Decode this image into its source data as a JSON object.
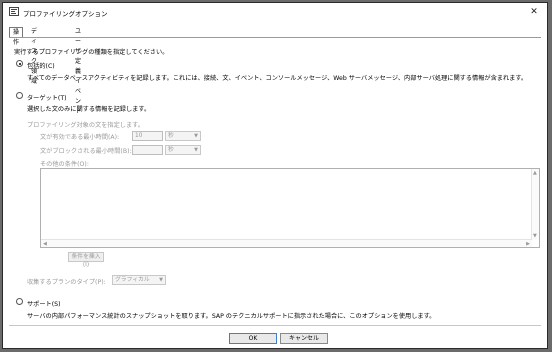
{
  "window": {
    "title": "プロファイリングオプション",
    "close_glyph": "✕"
  },
  "tabs": [
    {
      "label": "操作"
    },
    {
      "label": "ディスク領域"
    },
    {
      "label": "ユーザ定義イベント"
    }
  ],
  "instruction": "実行するプロファイリングの種類を指定してください。",
  "options": {
    "all": {
      "label": "包括的(C)",
      "description": "すべてのデータベースアクティビティを記録します。これには、接続、文、イベント、コンソールメッセージ、Web サーバメッセージ、内部サーバ処理に関する情報が含まれます。",
      "selected": true
    },
    "targeted": {
      "label": "ターゲット(T)",
      "description": "選択した文のみに関する情報を記録します。",
      "selected": false
    },
    "support": {
      "label": "サポート(S)",
      "description": "サーバの内部パフォーマンス統計のスナップショットを取ります。SAP のテクニカルサポートに指示された場合に、このオプションを使用します。",
      "selected": false
    }
  },
  "targeted_section": {
    "heading": "プロファイリング対象の文を指定します。",
    "min_exec_label": "文が有効である最小時間(A):",
    "min_exec_value": "10",
    "min_exec_unit": "秒",
    "min_block_label": "文がブロックされる最小時間(B):",
    "min_block_value": "",
    "min_block_unit": "秒",
    "other_conditions_label": "その他の条件(O):",
    "insert_condition_button": "条件を挿入(I)",
    "plan_type_label": "収集するプランのタイプ(P):",
    "plan_type_value": "グラフィカル"
  },
  "footer": {
    "ok": "OK",
    "cancel": "キャンセル"
  }
}
